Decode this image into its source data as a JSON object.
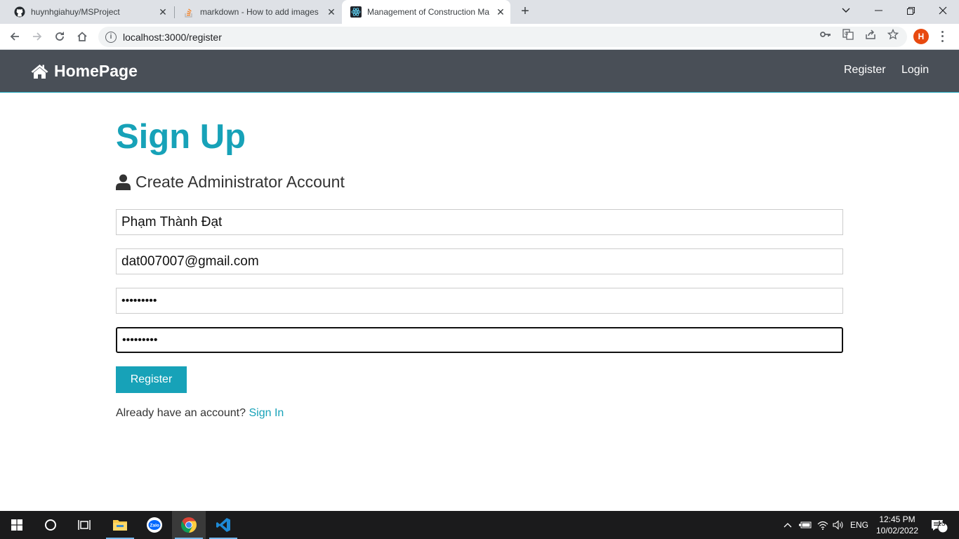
{
  "browser": {
    "tabs": [
      {
        "title": "huynhgiahuy/MSProject",
        "icon": "github-icon",
        "active": false
      },
      {
        "title": "markdown - How to add images",
        "icon": "stackoverflow-icon",
        "active": false
      },
      {
        "title": "Management of Construction Ma",
        "icon": "react-icon",
        "active": true
      }
    ],
    "url": "localhost:3000/register",
    "profile_initial": "H"
  },
  "navbar": {
    "brand": "HomePage",
    "links": [
      "Register",
      "Login"
    ]
  },
  "page": {
    "title": "Sign Up",
    "lead": "Create Administrator Account",
    "fields": {
      "name": "Phạm Thành Đạt",
      "email": "dat007007@gmail.com",
      "password": "•••••••••",
      "password_confirm": "•••••••••"
    },
    "register_button": "Register",
    "footer_text": "Already have an account?",
    "footer_link": "Sign In"
  },
  "taskbar": {
    "language": "ENG",
    "time": "12:45 PM",
    "date": "10/02/2022",
    "notifications": "13"
  },
  "colors": {
    "accent": "#17a2b8",
    "navbar": "#494f57",
    "tabstrip": "#dee1e6",
    "taskbar": "#1b1b1c"
  }
}
